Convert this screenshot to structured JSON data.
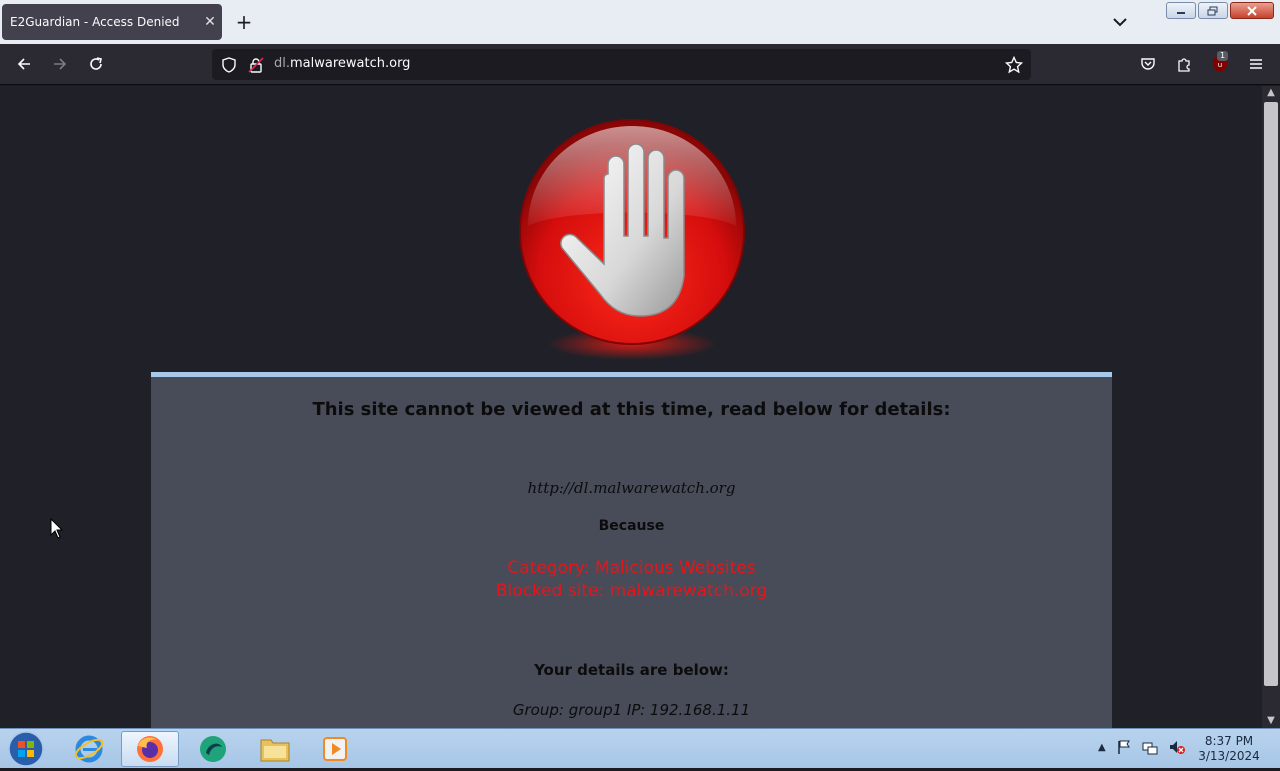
{
  "browser": {
    "tab_title": "E2Guardian - Access Denied",
    "tab_close": "✕",
    "new_tab": "+",
    "url_subdomain": "dl.",
    "url_domain": "malwarewatch.org",
    "extension_badge": "1"
  },
  "page": {
    "headline": "This site cannot be viewed at this time, read below for details:",
    "blocked_url": "http://dl.malwarewatch.org",
    "because_label": "Because",
    "reason_category": "Category: Malicious Websites",
    "reason_site": "Blocked site: malwarewatch.org",
    "details_title": "Your details are below:",
    "details_line": "Group: group1   IP: 192.168.1.11"
  },
  "taskbar": {
    "time": "8:37 PM",
    "date": "3/13/2024"
  },
  "colors": {
    "reason_text": "#e8141a",
    "panel_bg": "#474c58",
    "panel_border": "#a6c8ea",
    "page_bg": "#1f2028"
  }
}
